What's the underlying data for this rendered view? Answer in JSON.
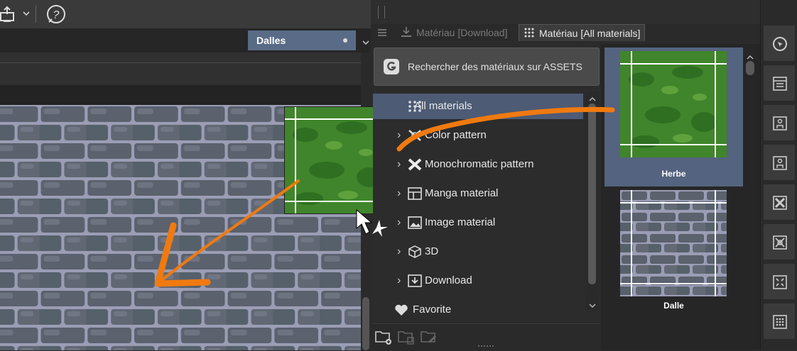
{
  "layer_panel": {
    "active_layer": "Dalles"
  },
  "material_panel": {
    "tabs": [
      {
        "label": "Matériau [Download]"
      },
      {
        "label": "Matériau [All materials]"
      }
    ],
    "search_button_label": "Rechercher des matériaux sur ASSETS",
    "tree": [
      {
        "label": "All materials",
        "icon": "grid-dots-icon",
        "selected": true
      },
      {
        "label": "Color pattern",
        "icon": "color-pattern-icon"
      },
      {
        "label": "Monochromatic pattern",
        "icon": "mono-pattern-icon"
      },
      {
        "label": "Manga material",
        "icon": "manga-icon"
      },
      {
        "label": "Image material",
        "icon": "image-icon"
      },
      {
        "label": "3D",
        "icon": "cube-icon"
      },
      {
        "label": "Download",
        "icon": "download-folder-icon"
      },
      {
        "label": "Favorite",
        "icon": "heart-icon"
      }
    ],
    "thumbnails": [
      {
        "label": "Herbe",
        "selected": true
      },
      {
        "label": "Dalle",
        "selected": false
      }
    ]
  },
  "colors": {
    "selection": "#4d5b75",
    "arrow": "#f07a10",
    "grass": "#3f8a2a",
    "stone": "#5e6472"
  }
}
